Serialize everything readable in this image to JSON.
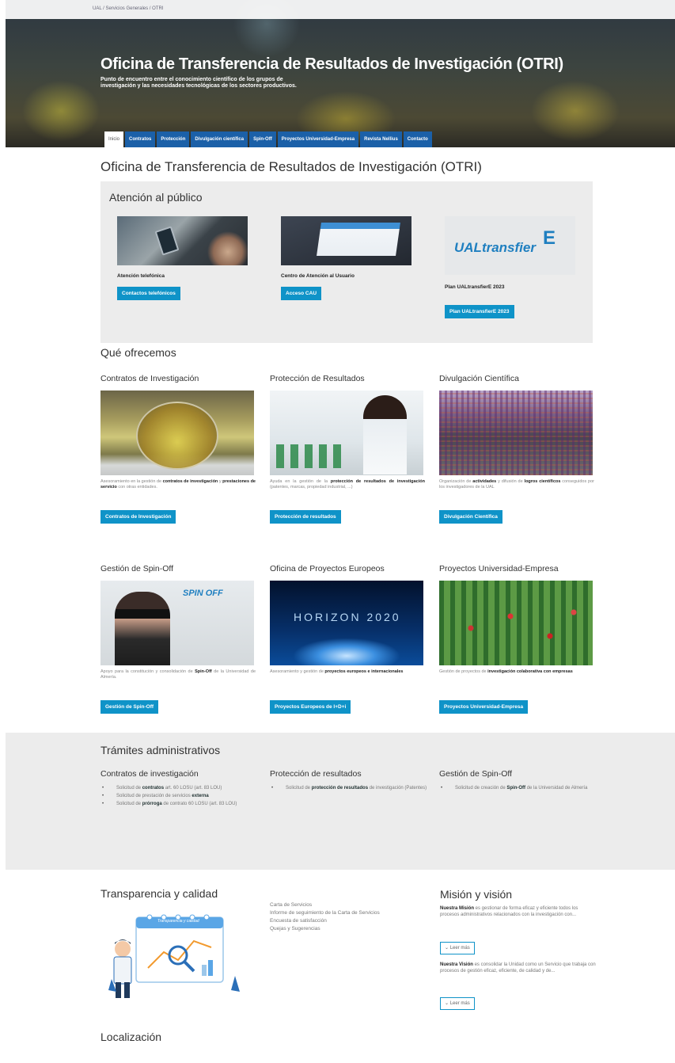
{
  "header": {
    "breadcrumb": "UAL / Servicios Generales / OTRI",
    "title": "Oficina de Transferencia de Resultados de Investigación (OTRI)",
    "subtitle_line1": "Punto de encuentro entre el conocimiento científico de los grupos de",
    "subtitle_line2": "investigación y las necesidades tecnológicas de los sectores productivos.",
    "tabs": [
      {
        "label": "Inicio",
        "active": true
      },
      {
        "label": "Contratos"
      },
      {
        "label": "Protección"
      },
      {
        "label": "Divulgación científica"
      },
      {
        "label": "Spin-Off"
      },
      {
        "label": "Proyectos Universidad-Empresa"
      },
      {
        "label": "Revista Nellius"
      },
      {
        "label": "Contacto"
      }
    ]
  },
  "page_title": "Oficina de Transferencia de Resultados de Investigación (OTRI)",
  "atencion": {
    "title": "Atención al público",
    "cards": [
      {
        "label": "Atención telefónica",
        "button": "Contactos telefónicos"
      },
      {
        "label": "Centro de Atención al Usuario",
        "button": "Acceso CAU"
      },
      {
        "label": "Plan UALtransfierE 2023",
        "button": "Plan UALtransfierE 2023",
        "logo_text": "UALtransfier",
        "logo_e": "E"
      }
    ]
  },
  "ofrecemos": {
    "title": "Qué ofrecemos",
    "services": [
      {
        "title": "Contratos de Investigación",
        "desc_a": "Asesoramiento en la gestión de ",
        "desc_b": "contratos de investigación",
        "desc_c": " y ",
        "desc_d": "prestaciones de servicio",
        "desc_e": " con otras entidades.",
        "button": "Contratos de Investigación"
      },
      {
        "title": "Protección de Resultados",
        "desc_a": "Ayuda en la gestión de la ",
        "desc_b": "protección de resultados de investigación",
        "desc_c": " (patentes, marcas, propiedad industrial, ...)",
        "button": "Protección de resultados"
      },
      {
        "title": "Divulgación Científica",
        "desc_a": "Organización de ",
        "desc_b": "actividades",
        "desc_c": " y difusión de ",
        "desc_d": "logros científicos",
        "desc_e": " conseguidos por los investigadores de la UAL",
        "button": "Divulgación Científica"
      },
      {
        "title": "Gestión de Spin-Off",
        "desc_a": "Apoyo para la constitución y consolidación de ",
        "desc_b": "Spin-Off",
        "desc_c": " de la Universidad de Almería.",
        "button": "Gestión de Spin-Off"
      },
      {
        "title": "Oficina de Proyectos Europeos",
        "desc_a": "Asesoramiento y gestión de ",
        "desc_b": "proyectos europeos e internacionales",
        "button": "Proyectos Europeos de I+D+i"
      },
      {
        "title": "Proyectos Universidad-Empresa",
        "desc_a": "Gestión de proyectos de ",
        "desc_b": "investigación colaborativa con empresas",
        "button": "Proyectos Universidad-Empresa"
      }
    ]
  },
  "tramites": {
    "title": "Trámites administrativos",
    "columns": [
      {
        "title": "Contratos de investigación",
        "items": [
          {
            "a": "Solicitud de ",
            "b": "contratos",
            "c": " art. 60 LOSU (art. 83 LOU)"
          },
          {
            "a": "Solicitud de prestación de servicios ",
            "b": "externa",
            "c": ""
          },
          {
            "a": "Solicitud de ",
            "b": "prórroga",
            "c": " de contrato 60 LOSU (art. 83 LOU)"
          }
        ]
      },
      {
        "title": "Protección de resultados",
        "items": [
          {
            "a": "Solicitud de ",
            "b": "protección de resultados",
            "c": " de investigación (Patentes)"
          }
        ]
      },
      {
        "title": "Gestión de Spin-Off",
        "items": [
          {
            "a": "Solicitud de creación de ",
            "b": "Spin-Off",
            "c": " de la Universidad de Almería"
          }
        ]
      }
    ]
  },
  "transparencia": {
    "title": "Transparencia y calidad",
    "illustration_label": "Transparencia y calidad",
    "links": [
      "Carta de Servicios",
      "Informe de seguimiento de la Carta de Servicios",
      "Encuesta de satisfacción",
      "Quejas y Sugerencias"
    ]
  },
  "mision": {
    "title": "Misión y visión",
    "mision_label": "Nuestra Misión",
    "mision_text": " es gestionar de forma eficaz y eficiente todos los procesos administrativos relacionados con la investigación con...",
    "vision_label": "Nuestra Visión",
    "vision_text": " es consolidar la Unidad como un Servicio que trabaja con procesos de gestión eficaz, eficiente, de calidad y de...",
    "leer_mas": "Leer más"
  },
  "localizacion": {
    "title": "Localización"
  },
  "colors": {
    "tab_blue": "#1b60a8",
    "button_blue": "#0f93c8",
    "panel_gray": "#ececec"
  }
}
